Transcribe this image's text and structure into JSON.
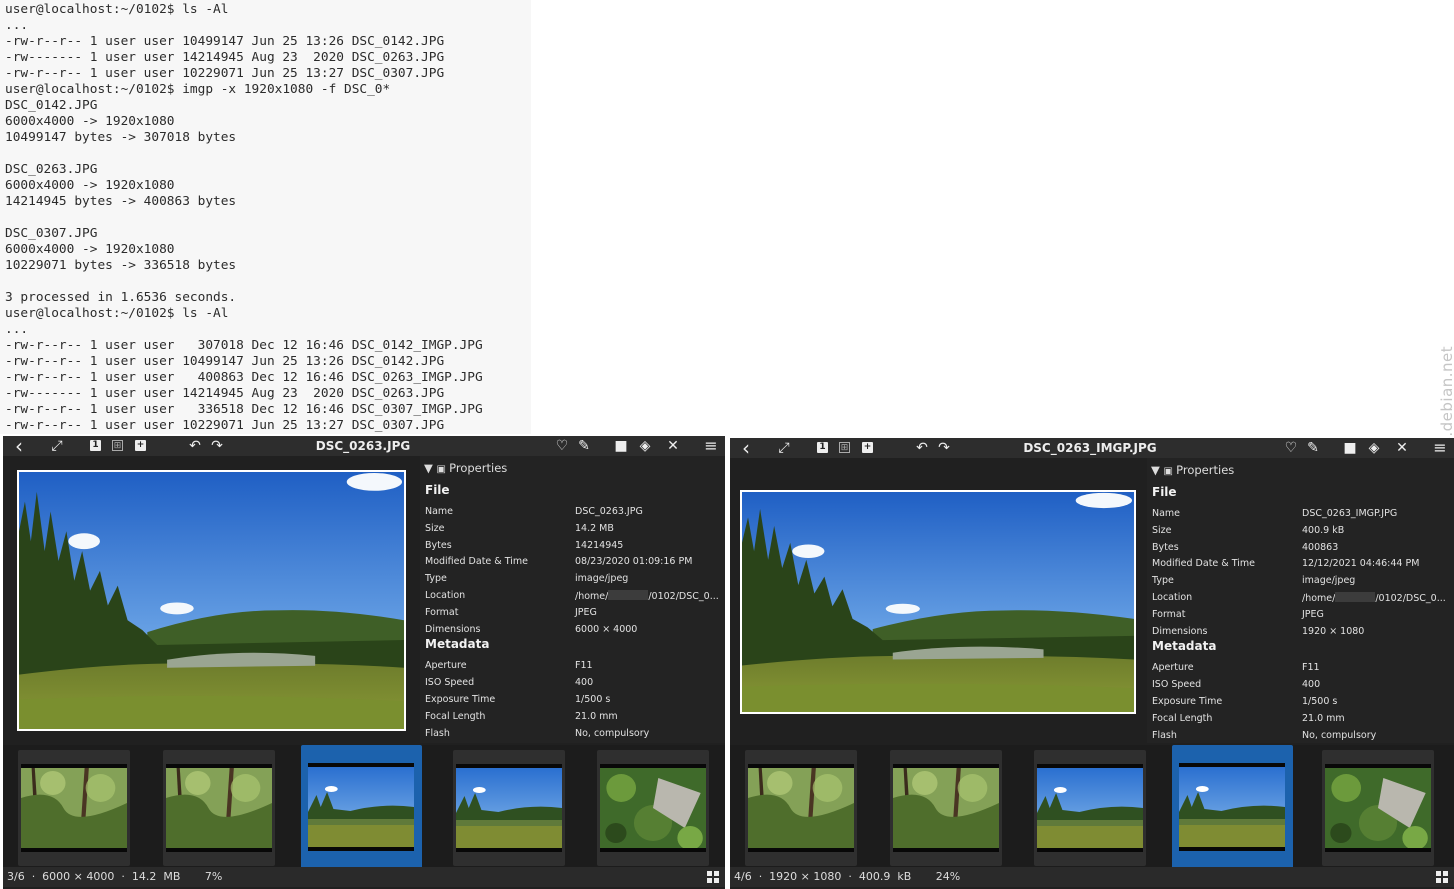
{
  "terminal": {
    "lines": [
      "user@localhost:~/0102$ ls -Al",
      "...",
      "-rw-r--r-- 1 user user 10499147 Jun 25 13:26 DSC_0142.JPG",
      "-rw------- 1 user user 14214945 Aug 23  2020 DSC_0263.JPG",
      "-rw-r--r-- 1 user user 10229071 Jun 25 13:27 DSC_0307.JPG",
      "user@localhost:~/0102$ imgp -x 1920x1080 -f DSC_0*",
      "DSC_0142.JPG",
      "6000x4000 -> 1920x1080",
      "10499147 bytes -> 307018 bytes",
      "",
      "DSC_0263.JPG",
      "6000x4000 -> 1920x1080",
      "14214945 bytes -> 400863 bytes",
      "",
      "DSC_0307.JPG",
      "6000x4000 -> 1920x1080",
      "10229071 bytes -> 336518 bytes",
      "",
      "3 processed in 1.6536 seconds.",
      "user@localhost:~/0102$ ls -Al",
      "...",
      "-rw-r--r-- 1 user user   307018 Dec 12 16:46 DSC_0142_IMGP.JPG",
      "-rw-r--r-- 1 user user 10499147 Jun 25 13:26 DSC_0142.JPG",
      "-rw-r--r-- 1 user user   400863 Dec 12 16:46 DSC_0263_IMGP.JPG",
      "-rw------- 1 user user 14214945 Aug 23  2020 DSC_0263.JPG",
      "-rw-r--r-- 1 user user   336518 Dec 12 16:46 DSC_0307_IMGP.JPG",
      "-rw-r--r-- 1 user user 10229071 Jun 25 13:27 DSC_0307.JPG"
    ]
  },
  "watermark": "screenshots.debian.net",
  "viewers": [
    {
      "title": "DSC_0263.JPG",
      "toolbar": {
        "back": "‹",
        "fullscreen": "⤢",
        "zoom_one": "1",
        "zoom_plus": "+",
        "rotate_left": "↶",
        "rotate_right": "↷",
        "menu": "≡"
      },
      "properties": {
        "header": "Properties",
        "file_title": "File",
        "file": [
          {
            "k": "Name",
            "v": "DSC_0263.JPG"
          },
          {
            "k": "Size",
            "v": "14.2  MB"
          },
          {
            "k": "Bytes",
            "v": "14214945"
          },
          {
            "k": "Modified Date & Time",
            "v": "08/23/2020 01:09:16 PM"
          },
          {
            "k": "Type",
            "v": "image/jpeg"
          },
          {
            "k": "Location",
            "v": "/home/",
            "v2": "/0102/DSC_0..."
          },
          {
            "k": "Format",
            "v": "JPEG"
          },
          {
            "k": "Dimensions",
            "v": "6000 × 4000"
          }
        ],
        "meta_title": "Metadata",
        "metadata": [
          {
            "k": "Aperture",
            "v": "F11"
          },
          {
            "k": "ISO Speed",
            "v": "400"
          },
          {
            "k": "Exposure Time",
            "v": "1/500 s"
          },
          {
            "k": "Focal Length",
            "v": "21.0 mm"
          },
          {
            "k": "Flash",
            "v": "No, compulsory"
          }
        ]
      },
      "thumbnails": [
        {
          "scene": "forest",
          "selected": false
        },
        {
          "scene": "forest",
          "selected": false
        },
        {
          "scene": "meadow",
          "selected": true
        },
        {
          "scene": "meadow",
          "selected": false
        },
        {
          "scene": "plants",
          "selected": false
        }
      ],
      "status": "3/6  ·  6000 × 4000  ·  14.2  MB       7%"
    },
    {
      "title": "DSC_0263_IMGP.JPG",
      "toolbar": {
        "back": "‹",
        "fullscreen": "⤢",
        "zoom_one": "1",
        "zoom_plus": "+",
        "rotate_left": "↶",
        "rotate_right": "↷",
        "menu": "≡"
      },
      "properties": {
        "header": "Properties",
        "file_title": "File",
        "file": [
          {
            "k": "Name",
            "v": "DSC_0263_IMGP.JPG"
          },
          {
            "k": "Size",
            "v": "400.9  kB"
          },
          {
            "k": "Bytes",
            "v": "400863"
          },
          {
            "k": "Modified Date & Time",
            "v": "12/12/2021 04:46:44 PM"
          },
          {
            "k": "Type",
            "v": "image/jpeg"
          },
          {
            "k": "Location",
            "v": "/home/",
            "v2": "/0102/DSC_0..."
          },
          {
            "k": "Format",
            "v": "JPEG"
          },
          {
            "k": "Dimensions",
            "v": "1920 × 1080"
          }
        ],
        "meta_title": "Metadata",
        "metadata": [
          {
            "k": "Aperture",
            "v": "F11"
          },
          {
            "k": "ISO Speed",
            "v": "400"
          },
          {
            "k": "Exposure Time",
            "v": "1/500 s"
          },
          {
            "k": "Focal Length",
            "v": "21.0 mm"
          },
          {
            "k": "Flash",
            "v": "No, compulsory"
          }
        ]
      },
      "thumbnails": [
        {
          "scene": "forest",
          "selected": false
        },
        {
          "scene": "forest",
          "selected": false
        },
        {
          "scene": "meadow",
          "selected": false
        },
        {
          "scene": "meadow",
          "selected": true
        },
        {
          "scene": "plants",
          "selected": false
        }
      ],
      "status": "4/6  ·  1920 × 1080  ·  400.9  kB       24%"
    }
  ]
}
